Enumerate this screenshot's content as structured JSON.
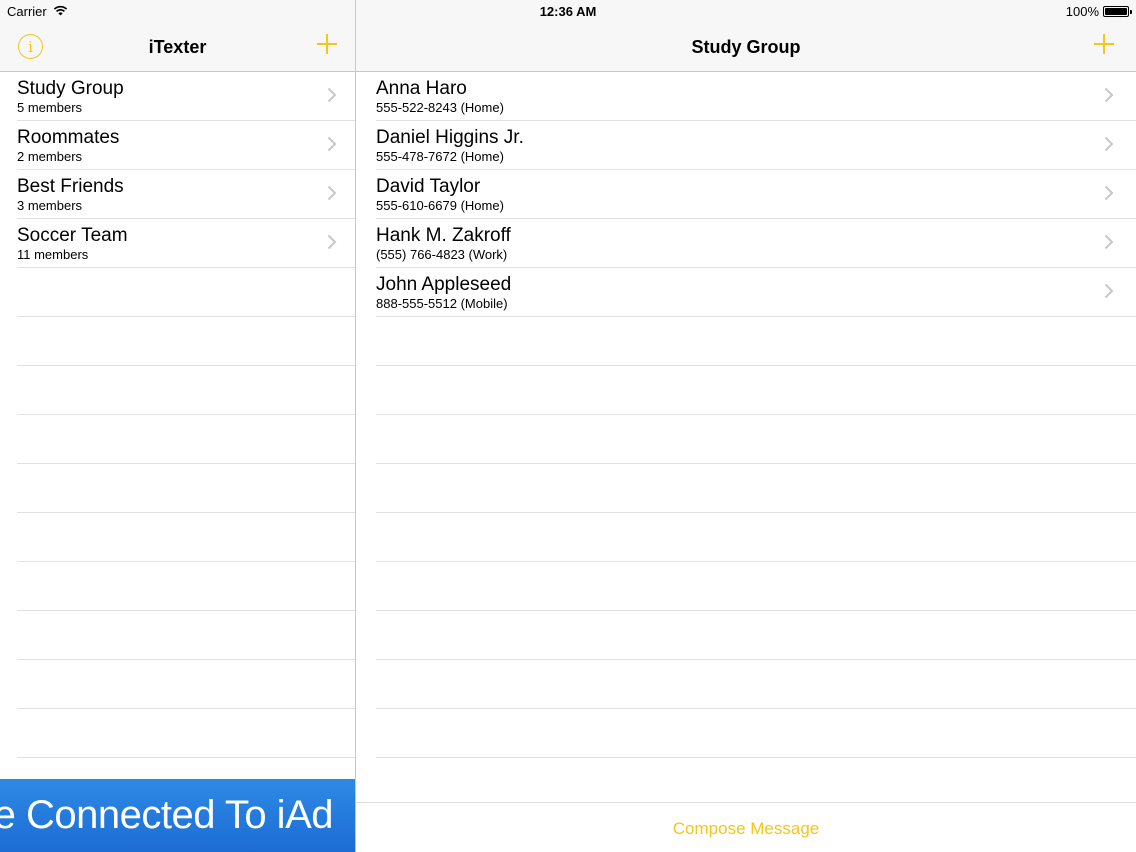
{
  "status_bar": {
    "carrier": "Carrier",
    "time": "12:36 AM",
    "battery": "100%",
    "battery_level": 1.0
  },
  "master": {
    "title": "iTexter",
    "groups": [
      {
        "name": "Study Group",
        "members": "5 members"
      },
      {
        "name": "Roommates",
        "members": "2 members"
      },
      {
        "name": "Best Friends",
        "members": "3 members"
      },
      {
        "name": "Soccer Team",
        "members": "11 members"
      }
    ],
    "empty_rows": 10
  },
  "ad_banner": {
    "text": "You're Connected To iAd"
  },
  "detail": {
    "title": "Study Group",
    "contacts": [
      {
        "name": "Anna Haro",
        "phone": "555-522-8243 (Home)"
      },
      {
        "name": "Daniel Higgins Jr.",
        "phone": "555-478-7672 (Home)"
      },
      {
        "name": "David Taylor",
        "phone": "555-610-6679 (Home)"
      },
      {
        "name": "Hank M. Zakroff",
        "phone": "(555) 766-4823 (Work)"
      },
      {
        "name": "John Appleseed",
        "phone": "888-555-5512 (Mobile)"
      }
    ],
    "empty_rows": 10,
    "compose_label": "Compose Message"
  },
  "colors": {
    "accent": "#f5c518",
    "bar_background": "#f7f7f7",
    "separator": "#e0e0e4",
    "ad_blue": "#1c6cd4"
  }
}
